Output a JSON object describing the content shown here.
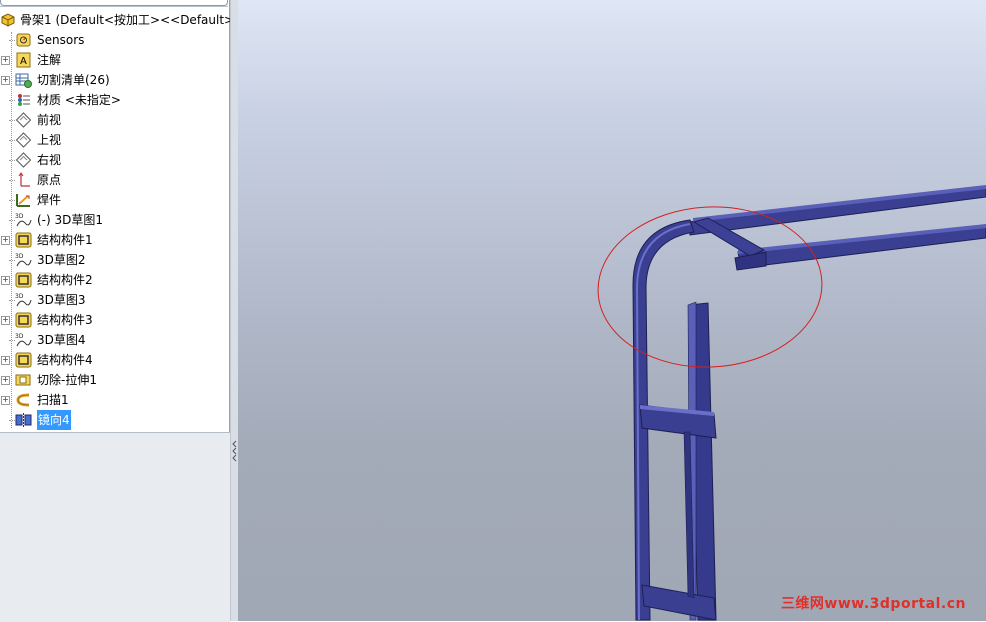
{
  "tree": {
    "root_label": "骨架1  (Default<按加工><<Default>_",
    "items": [
      {
        "label": "Sensors",
        "icon": "sensors-icon",
        "expandable": false
      },
      {
        "label": "注解",
        "icon": "annotations-icon",
        "expandable": true
      },
      {
        "label": "切割清单(26)",
        "icon": "cut-list-icon",
        "expandable": true
      },
      {
        "label": "材质 <未指定>",
        "icon": "material-icon",
        "expandable": false
      },
      {
        "label": "前视",
        "icon": "plane-icon",
        "expandable": false
      },
      {
        "label": "上视",
        "icon": "plane-icon",
        "expandable": false
      },
      {
        "label": "右视",
        "icon": "plane-icon",
        "expandable": false
      },
      {
        "label": "原点",
        "icon": "origin-icon",
        "expandable": false
      },
      {
        "label": "焊件",
        "icon": "weldment-icon",
        "expandable": false
      },
      {
        "label": "(-) 3D草图1",
        "icon": "3d-sketch-icon",
        "expandable": false
      },
      {
        "label": "结构构件1",
        "icon": "structural-member-icon",
        "expandable": true
      },
      {
        "label": "3D草图2",
        "icon": "3d-sketch-icon",
        "expandable": false
      },
      {
        "label": "结构构件2",
        "icon": "structural-member-icon",
        "expandable": true
      },
      {
        "label": "3D草图3",
        "icon": "3d-sketch-icon",
        "expandable": false
      },
      {
        "label": "结构构件3",
        "icon": "structural-member-icon",
        "expandable": true
      },
      {
        "label": "3D草图4",
        "icon": "3d-sketch-icon",
        "expandable": false
      },
      {
        "label": "结构构件4",
        "icon": "structural-member-icon",
        "expandable": true
      },
      {
        "label": "切除-拉伸1",
        "icon": "cut-extrude-icon",
        "expandable": true
      },
      {
        "label": "扫描1",
        "icon": "sweep-icon",
        "expandable": true
      },
      {
        "label": "镜向4",
        "icon": "mirror-icon",
        "expandable": false,
        "selected": true
      }
    ]
  },
  "watermark": "三维网www.3dportal.cn",
  "colors": {
    "model": "#3b3f92",
    "selection": "#3399ff",
    "annotation_circle": "#d42020",
    "watermark": "#e0302a"
  }
}
